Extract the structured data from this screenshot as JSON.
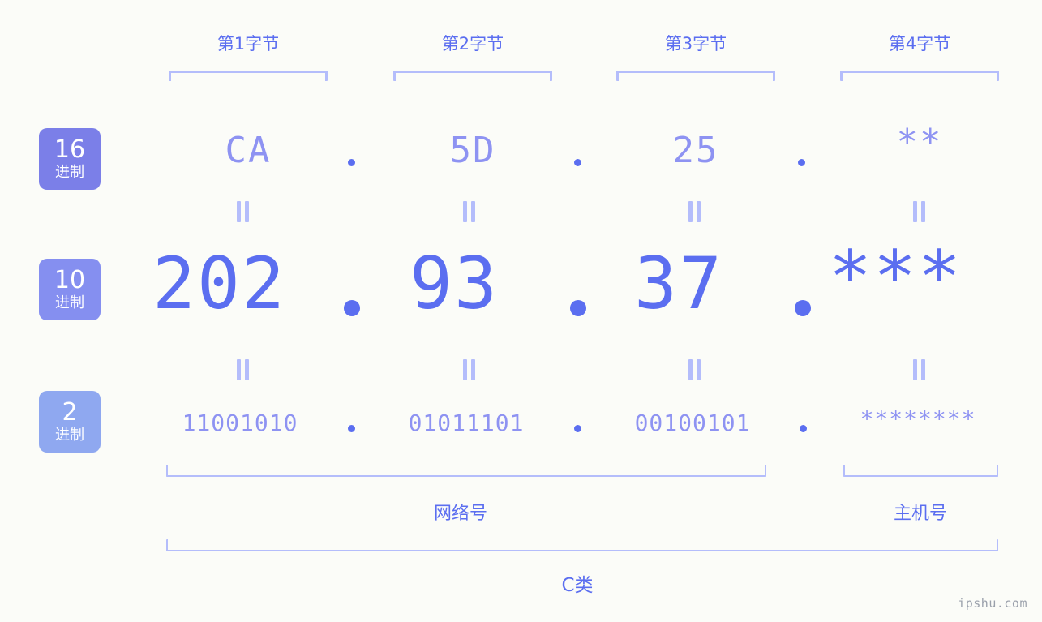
{
  "watermark": "ipshu.com",
  "byte_headers": [
    {
      "label": "第1字节"
    },
    {
      "label": "第2字节"
    },
    {
      "label": "第3字节"
    },
    {
      "label": "第4字节"
    }
  ],
  "radix_badges": [
    {
      "num": "16",
      "sub": "进制",
      "color": "#7b7fe8"
    },
    {
      "num": "10",
      "sub": "进制",
      "color": "#858ff0"
    },
    {
      "num": "2",
      "sub": "进制",
      "color": "#8fa8f0"
    }
  ],
  "rows": {
    "hex": {
      "values": [
        "CA",
        "5D",
        "25",
        "**"
      ]
    },
    "decimal": {
      "values": [
        "202",
        "93",
        "37",
        "***"
      ]
    },
    "binary": {
      "values": [
        "11001010",
        "01011101",
        "00100101",
        "********"
      ]
    }
  },
  "separators": {
    "dot": ".",
    "equals": "="
  },
  "footer": {
    "network_label": "网络号",
    "host_label": "主机号",
    "class_label": "C类"
  }
}
